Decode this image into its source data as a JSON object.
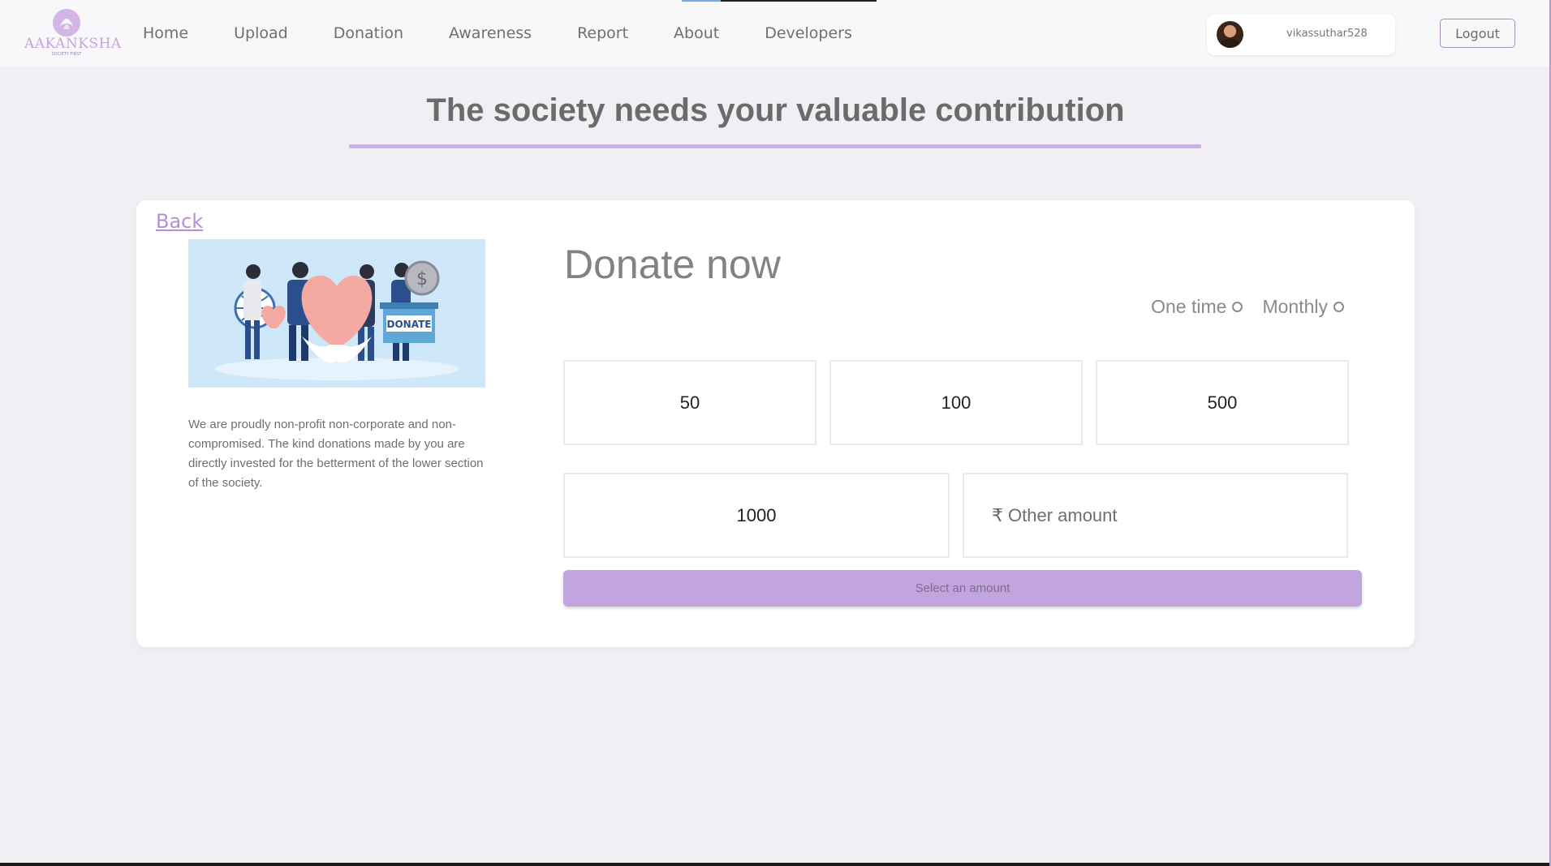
{
  "brand": {
    "name": "AAKANKSHA",
    "tagline": "SOCIETY FIRST",
    "accent_color": "#c2a5de"
  },
  "nav": {
    "items": [
      {
        "label": "Home"
      },
      {
        "label": "Upload"
      },
      {
        "label": "Donation"
      },
      {
        "label": "Awareness"
      },
      {
        "label": "Report"
      },
      {
        "label": "About"
      },
      {
        "label": "Developers"
      }
    ]
  },
  "user": {
    "username": "vikassuthar528",
    "logout_label": "Logout"
  },
  "page": {
    "title": "The society needs your valuable contribution"
  },
  "donation": {
    "back_label": "Back",
    "description": "We are proudly non-profit non-corporate and non-compromised. The kind donations made by you are directly invested for the betterment of the lower section of the society.",
    "heading": "Donate now",
    "frequency_options": [
      {
        "label": "One time",
        "selected": false
      },
      {
        "label": "Monthly",
        "selected": false
      }
    ],
    "amounts": [
      "50",
      "100",
      "500",
      "1000"
    ],
    "currency_symbol": "₹",
    "other_placeholder": "Other amount",
    "submit_label": "Select an amount",
    "illustration_label": "DONATE"
  }
}
